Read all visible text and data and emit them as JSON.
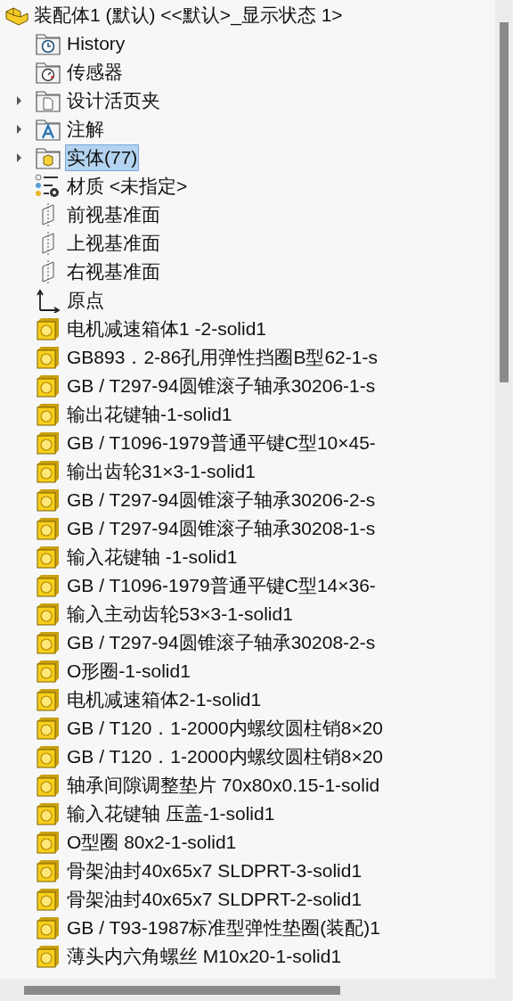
{
  "tree": {
    "root": {
      "label": "装配体1 (默认) <<默认>_显示状态 1>"
    },
    "items": [
      {
        "kind": "history",
        "label": "History",
        "selected": false
      },
      {
        "kind": "sensor",
        "label": "传感器",
        "selected": false
      },
      {
        "kind": "binder",
        "label": "设计活页夹",
        "selected": false,
        "expanded": false
      },
      {
        "kind": "annotation",
        "label": "注解",
        "selected": false,
        "expanded": false
      },
      {
        "kind": "bodies",
        "label": "实体(77)",
        "selected": true,
        "expanded": false
      },
      {
        "kind": "material",
        "label": "材质 <未指定>",
        "selected": false
      },
      {
        "kind": "plane",
        "label": "前视基准面",
        "selected": false
      },
      {
        "kind": "plane",
        "label": "上视基准面",
        "selected": false
      },
      {
        "kind": "plane",
        "label": "右视基准面",
        "selected": false
      },
      {
        "kind": "origin",
        "label": "原点",
        "selected": false
      },
      {
        "kind": "body",
        "label": "电机减速箱体1 -2-solid1",
        "selected": false
      },
      {
        "kind": "body",
        "label": "GB893．2-86孔用弹性挡圈B型62-1-s",
        "selected": false
      },
      {
        "kind": "body",
        "label": "GB / T297-94圆锥滚子轴承30206-1-s",
        "selected": false
      },
      {
        "kind": "body",
        "label": "输出花键轴-1-solid1",
        "selected": false
      },
      {
        "kind": "body",
        "label": "GB / T1096-1979普通平键C型10×45-",
        "selected": false
      },
      {
        "kind": "body",
        "label": "输出齿轮31×3-1-solid1",
        "selected": false
      },
      {
        "kind": "body",
        "label": "GB / T297-94圆锥滚子轴承30206-2-s",
        "selected": false
      },
      {
        "kind": "body",
        "label": "GB / T297-94圆锥滚子轴承30208-1-s",
        "selected": false
      },
      {
        "kind": "body",
        "label": "输入花键轴 -1-solid1",
        "selected": false
      },
      {
        "kind": "body",
        "label": "GB / T1096-1979普通平键C型14×36-",
        "selected": false
      },
      {
        "kind": "body",
        "label": "输入主动齿轮53×3-1-solid1",
        "selected": false
      },
      {
        "kind": "body",
        "label": "GB / T297-94圆锥滚子轴承30208-2-s",
        "selected": false
      },
      {
        "kind": "body",
        "label": "O形圈-1-solid1",
        "selected": false
      },
      {
        "kind": "body",
        "label": "电机减速箱体2-1-solid1",
        "selected": false
      },
      {
        "kind": "body",
        "label": "GB / T120．1-2000内螺纹圆柱销8×20",
        "selected": false
      },
      {
        "kind": "body",
        "label": "GB / T120．1-2000内螺纹圆柱销8×20",
        "selected": false
      },
      {
        "kind": "body",
        "label": "轴承间隙调整垫片 70x80x0.15-1-solid",
        "selected": false
      },
      {
        "kind": "body",
        "label": "输入花键轴 压盖-1-solid1",
        "selected": false
      },
      {
        "kind": "body",
        "label": "O型圈  80x2-1-solid1",
        "selected": false
      },
      {
        "kind": "body",
        "label": "骨架油封40x65x7 SLDPRT-3-solid1",
        "selected": false
      },
      {
        "kind": "body",
        "label": "骨架油封40x65x7 SLDPRT-2-solid1",
        "selected": false
      },
      {
        "kind": "body",
        "label": "GB / T93-1987标准型弹性垫圈(装配)1",
        "selected": false
      },
      {
        "kind": "body",
        "label": "薄头内六角螺丝 M10x20-1-solid1",
        "selected": false
      }
    ]
  }
}
